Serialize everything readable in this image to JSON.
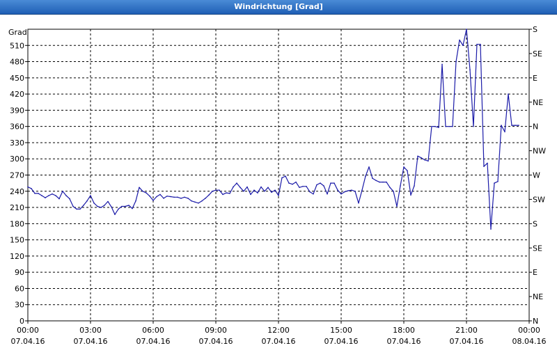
{
  "window": {
    "title": "Windrichtung [Grad]"
  },
  "chart_data": {
    "type": "line",
    "title": "Windrichtung [Grad]",
    "ylabel": "Grad",
    "xlabel": "",
    "ylim": [
      0,
      540
    ],
    "xlim_hours": [
      0,
      24
    ],
    "grid": true,
    "y_ticks": [
      0,
      30,
      60,
      90,
      120,
      150,
      180,
      210,
      240,
      270,
      300,
      330,
      360,
      390,
      420,
      450,
      480,
      510
    ],
    "right_ticks": [
      {
        "value": 0,
        "label": "N"
      },
      {
        "value": 45,
        "label": "NE"
      },
      {
        "value": 90,
        "label": "E"
      },
      {
        "value": 135,
        "label": "SE"
      },
      {
        "value": 180,
        "label": "S"
      },
      {
        "value": 225,
        "label": "SW"
      },
      {
        "value": 270,
        "label": "W"
      },
      {
        "value": 315,
        "label": "NW"
      },
      {
        "value": 360,
        "label": "N"
      },
      {
        "value": 405,
        "label": "NE"
      },
      {
        "value": 450,
        "label": "E"
      },
      {
        "value": 495,
        "label": "SE"
      },
      {
        "value": 540,
        "label": "S"
      }
    ],
    "x_ticks": [
      {
        "time": "00:00",
        "date": "07.04.16"
      },
      {
        "time": "03:00",
        "date": "07.04.16"
      },
      {
        "time": "06:00",
        "date": "07.04.16"
      },
      {
        "time": "09:00",
        "date": "07.04.16"
      },
      {
        "time": "12:00",
        "date": "07.04.16"
      },
      {
        "time": "15:00",
        "date": "07.04.16"
      },
      {
        "time": "18:00",
        "date": "07.04.16"
      },
      {
        "time": "21:00",
        "date": "07.04.16"
      },
      {
        "time": "00:00",
        "date": "08.04.16"
      }
    ],
    "colors": {
      "line": "#1a1aa8",
      "grid": "#000000"
    },
    "series": [
      {
        "name": "",
        "points": [
          [
            "07.04.16 00:00",
            248
          ],
          [
            "07.04.16 00:10",
            245
          ],
          [
            "07.04.16 00:20",
            236
          ],
          [
            "07.04.16 00:30",
            236
          ],
          [
            "07.04.16 00:40",
            232
          ],
          [
            "07.04.16 00:50",
            228
          ],
          [
            "07.04.16 01:00",
            232
          ],
          [
            "07.04.16 01:10",
            235
          ],
          [
            "07.04.16 01:20",
            232
          ],
          [
            "07.04.16 01:30",
            226
          ],
          [
            "07.04.16 01:40",
            240
          ],
          [
            "07.04.16 01:50",
            232
          ],
          [
            "07.04.16 02:00",
            226
          ],
          [
            "07.04.16 02:10",
            212
          ],
          [
            "07.04.16 02:20",
            207
          ],
          [
            "07.04.16 02:30",
            207
          ],
          [
            "07.04.16 02:40",
            214
          ],
          [
            "07.04.16 02:50",
            222
          ],
          [
            "07.04.16 03:00",
            232
          ],
          [
            "07.04.16 03:10",
            218
          ],
          [
            "07.04.16 03:20",
            212
          ],
          [
            "07.04.16 03:30",
            210
          ],
          [
            "07.04.16 03:40",
            214
          ],
          [
            "07.04.16 03:50",
            221
          ],
          [
            "07.04.16 04:00",
            211
          ],
          [
            "07.04.16 04:10",
            197
          ],
          [
            "07.04.16 04:20",
            207
          ],
          [
            "07.04.16 04:30",
            212
          ],
          [
            "07.04.16 04:40",
            212
          ],
          [
            "07.04.16 04:50",
            214
          ],
          [
            "07.04.16 05:00",
            208
          ],
          [
            "07.04.16 05:10",
            222
          ],
          [
            "07.04.16 05:20",
            247
          ],
          [
            "07.04.16 05:30",
            240
          ],
          [
            "07.04.16 05:40",
            237
          ],
          [
            "07.04.16 05:50",
            231
          ],
          [
            "07.04.16 06:00",
            223
          ],
          [
            "07.04.16 06:10",
            230
          ],
          [
            "07.04.16 06:20",
            234
          ],
          [
            "07.04.16 06:30",
            227
          ],
          [
            "07.04.16 06:40",
            231
          ],
          [
            "07.04.16 06:50",
            230
          ],
          [
            "07.04.16 07:00",
            229
          ],
          [
            "07.04.16 07:10",
            229
          ],
          [
            "07.04.16 07:20",
            227
          ],
          [
            "07.04.16 07:30",
            229
          ],
          [
            "07.04.16 07:40",
            227
          ],
          [
            "07.04.16 07:50",
            222
          ],
          [
            "07.04.16 08:00",
            220
          ],
          [
            "07.04.16 08:10",
            218
          ],
          [
            "07.04.16 08:20",
            222
          ],
          [
            "07.04.16 08:30",
            227
          ],
          [
            "07.04.16 08:40",
            233
          ],
          [
            "07.04.16 08:50",
            240
          ],
          [
            "07.04.16 09:00",
            242
          ],
          [
            "07.04.16 09:10",
            242
          ],
          [
            "07.04.16 09:20",
            234
          ],
          [
            "07.04.16 09:30",
            237
          ],
          [
            "07.04.16 09:40",
            236
          ],
          [
            "07.04.16 09:50",
            248
          ],
          [
            "07.04.16 10:00",
            255
          ],
          [
            "07.04.16 10:10",
            247
          ],
          [
            "07.04.16 10:20",
            240
          ],
          [
            "07.04.16 10:30",
            248
          ],
          [
            "07.04.16 10:40",
            234
          ],
          [
            "07.04.16 10:50",
            242
          ],
          [
            "07.04.16 11:00",
            237
          ],
          [
            "07.04.16 11:10",
            248
          ],
          [
            "07.04.16 11:20",
            240
          ],
          [
            "07.04.16 11:30",
            247
          ],
          [
            "07.04.16 11:40",
            238
          ],
          [
            "07.04.16 11:50",
            242
          ],
          [
            "07.04.16 12:00",
            232
          ],
          [
            "07.04.16 12:10",
            265
          ],
          [
            "07.04.16 12:20",
            268
          ],
          [
            "07.04.16 12:30",
            255
          ],
          [
            "07.04.16 12:40",
            253
          ],
          [
            "07.04.16 12:50",
            257
          ],
          [
            "07.04.16 13:00",
            247
          ],
          [
            "07.04.16 13:10",
            249
          ],
          [
            "07.04.16 13:20",
            249
          ],
          [
            "07.04.16 13:30",
            239
          ],
          [
            "07.04.16 13:40",
            235
          ],
          [
            "07.04.16 13:50",
            252
          ],
          [
            "07.04.16 14:00",
            255
          ],
          [
            "07.04.16 14:10",
            250
          ],
          [
            "07.04.16 14:20",
            235
          ],
          [
            "07.04.16 14:30",
            255
          ],
          [
            "07.04.16 14:40",
            255
          ],
          [
            "07.04.16 14:50",
            242
          ],
          [
            "07.04.16 15:00",
            235
          ],
          [
            "07.04.16 15:10",
            239
          ],
          [
            "07.04.16 15:20",
            241
          ],
          [
            "07.04.16 15:30",
            242
          ],
          [
            "07.04.16 15:40",
            240
          ],
          [
            "07.04.16 15:50",
            218
          ],
          [
            "07.04.16 16:00",
            242
          ],
          [
            "07.04.16 16:10",
            268
          ],
          [
            "07.04.16 16:20",
            285
          ],
          [
            "07.04.16 16:30",
            264
          ],
          [
            "07.04.16 16:40",
            260
          ],
          [
            "07.04.16 16:50",
            257
          ],
          [
            "07.04.16 17:00",
            257
          ],
          [
            "07.04.16 17:10",
            257
          ],
          [
            "07.04.16 17:20",
            247
          ],
          [
            "07.04.16 17:30",
            240
          ],
          [
            "07.04.16 17:40",
            212
          ],
          [
            "07.04.16 17:50",
            250
          ],
          [
            "07.04.16 18:00",
            285
          ],
          [
            "07.04.16 18:10",
            278
          ],
          [
            "07.04.16 18:20",
            233
          ],
          [
            "07.04.16 18:30",
            250
          ],
          [
            "07.04.16 18:40",
            305
          ],
          [
            "07.04.16 18:50",
            302
          ],
          [
            "07.04.16 19:00",
            298
          ],
          [
            "07.04.16 19:10",
            296
          ],
          [
            "07.04.16 19:20",
            360
          ],
          [
            "07.04.16 19:30",
            360
          ],
          [
            "07.04.16 19:40",
            358
          ],
          [
            "07.04.16 19:50",
            475
          ],
          [
            "07.04.16 20:00",
            360
          ],
          [
            "07.04.16 20:10",
            360
          ],
          [
            "07.04.16 20:20",
            360
          ],
          [
            "07.04.16 20:30",
            480
          ],
          [
            "07.04.16 20:40",
            520
          ],
          [
            "07.04.16 20:50",
            510
          ],
          [
            "07.04.16 21:00",
            540
          ],
          [
            "07.04.16 21:10",
            465
          ],
          [
            "07.04.16 21:20",
            360
          ],
          [
            "07.04.16 21:30",
            512
          ],
          [
            "07.04.16 21:40",
            512
          ],
          [
            "07.04.16 21:50",
            286
          ],
          [
            "07.04.16 22:00",
            292
          ],
          [
            "07.04.16 22:10",
            170
          ],
          [
            "07.04.16 22:20",
            255
          ],
          [
            "07.04.16 22:30",
            258
          ],
          [
            "07.04.16 22:40",
            362
          ],
          [
            "07.04.16 22:50",
            350
          ],
          [
            "07.04.16 23:00",
            420
          ],
          [
            "07.04.16 23:10",
            362
          ],
          [
            "07.04.16 23:20",
            362
          ],
          [
            "07.04.16 23:30",
            362
          ]
        ]
      }
    ]
  }
}
